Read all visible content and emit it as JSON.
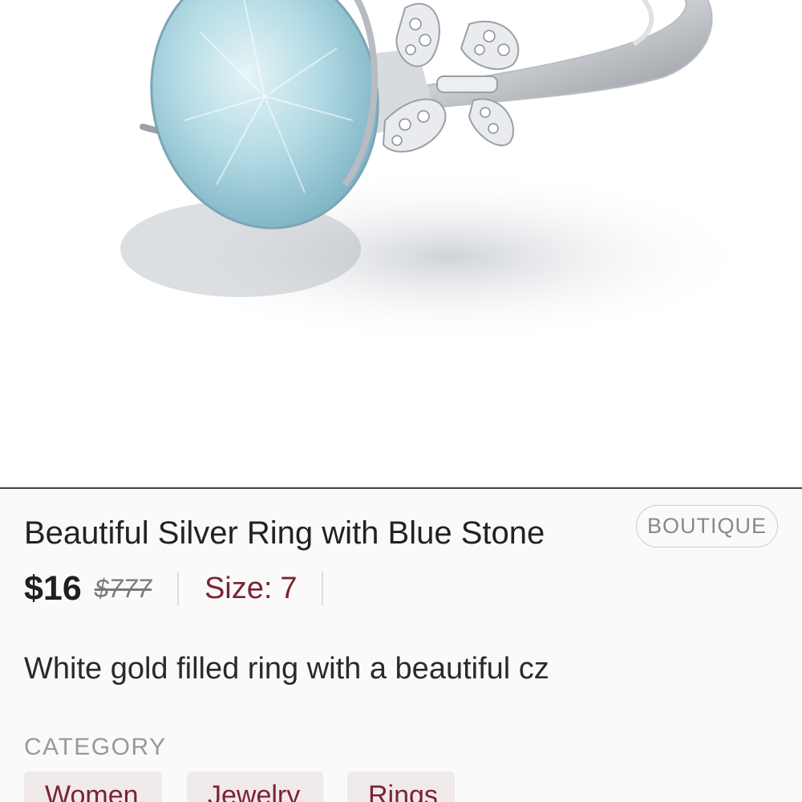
{
  "product": {
    "title": "Beautiful Silver Ring with Blue Stone",
    "badge": "BOUTIQUE",
    "price": "$16",
    "original_price": "$777",
    "size_label": "Size:",
    "size_value": "7",
    "description": "White gold filled ring with a beautiful cz",
    "image_subject": "ring-with-blue-oval-stone"
  },
  "category": {
    "label": "CATEGORY",
    "chips": [
      "Women",
      "Jewelry",
      "Rings"
    ]
  },
  "colors": {
    "accent": "#7a2333",
    "chip_background": "#f0eaea",
    "stone": "#a9d3df",
    "divider": "#444444"
  }
}
